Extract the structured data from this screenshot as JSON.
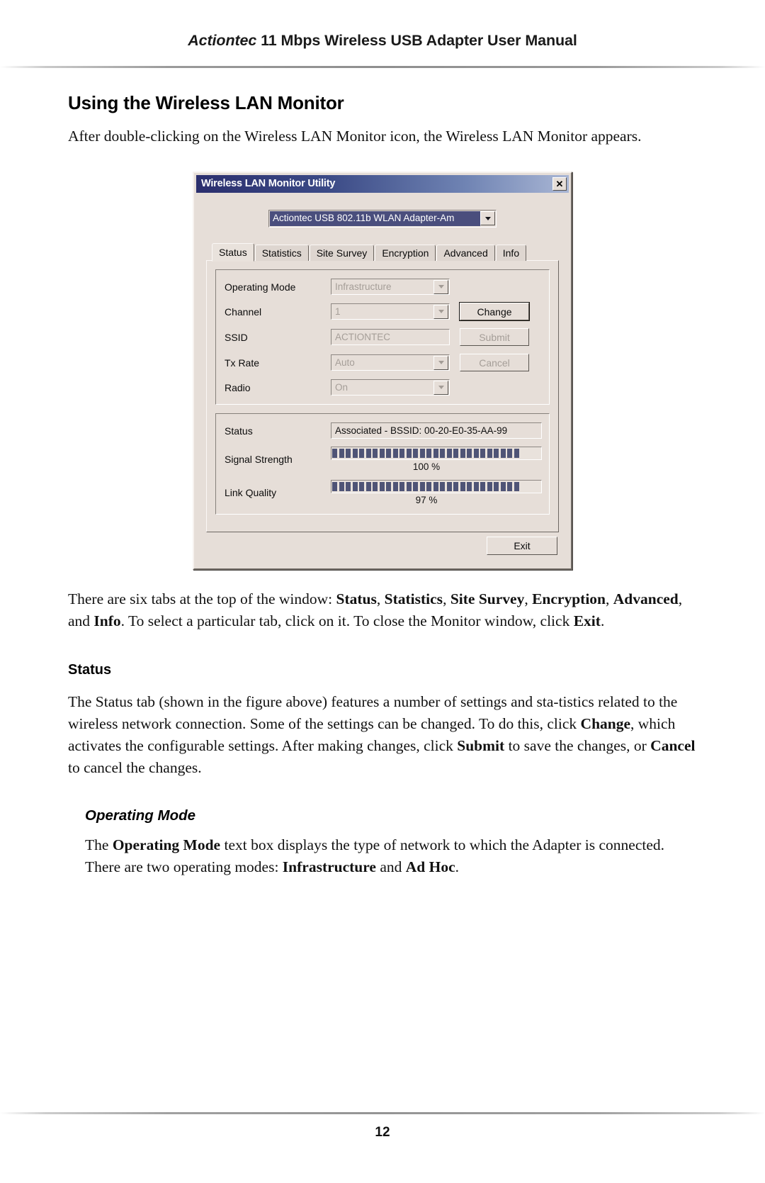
{
  "header": {
    "brand": "Actiontec",
    "title_rest": " 11 Mbps Wireless USB Adapter User Manual"
  },
  "section": {
    "title": "Using the Wireless LAN Monitor",
    "intro": "After double-clicking on the  Wireless LAN Monitor icon, the Wireless LAN Monitor appears."
  },
  "dialog": {
    "title": "Wireless LAN Monitor Utility",
    "close_label": "✕",
    "adapter": {
      "value": "Actiontec USB 802.11b WLAN Adapter-Am"
    },
    "tabs": [
      {
        "label": "Status",
        "active": true
      },
      {
        "label": "Statistics",
        "active": false
      },
      {
        "label": "Site Survey",
        "active": false
      },
      {
        "label": "Encryption",
        "active": false
      },
      {
        "label": "Advanced",
        "active": false
      },
      {
        "label": "Info",
        "active": false
      }
    ],
    "settings": [
      {
        "label": "Operating Mode",
        "value": "Infrastructure",
        "type": "combo",
        "enabled": false
      },
      {
        "label": "Channel",
        "value": "1",
        "type": "combo",
        "enabled": false
      },
      {
        "label": "SSID",
        "value": "ACTIONTEC",
        "type": "text",
        "enabled": false
      },
      {
        "label": "Tx Rate",
        "value": "Auto",
        "type": "combo",
        "enabled": false
      },
      {
        "label": "Radio",
        "value": "On",
        "type": "combo",
        "enabled": false
      }
    ],
    "buttons": {
      "change": "Change",
      "submit": "Submit",
      "cancel": "Cancel",
      "exit": "Exit"
    },
    "status": {
      "status_label": "Status",
      "status_value": "Associated - BSSID: 00-20-E0-35-AA-99",
      "signal_label": "Signal Strength",
      "signal_pct": "100 %",
      "signal_segments": 28,
      "link_label": "Link Quality",
      "link_pct": "97 %",
      "link_segments": 28
    }
  },
  "paragraphs": {
    "tabs_note_1": "There are six tabs at the top of the window: ",
    "tabs_note_b1": "Status",
    "tabs_note_2": ", ",
    "tabs_note_b2": "Statistics",
    "tabs_note_3": ", ",
    "tabs_note_b3": "Site Survey",
    "tabs_note_4": ", ",
    "tabs_note_b4": "Encryption",
    "tabs_note_5": ", ",
    "tabs_note_b5": "Advanced",
    "tabs_note_6": ", and ",
    "tabs_note_b6": "Info",
    "tabs_note_7": ". To select a particular tab, click on it. To close the Monitor window, click ",
    "tabs_note_b7": "Exit",
    "tabs_note_8": "."
  },
  "status_section": {
    "heading": "Status",
    "p1_a": "The Status tab (shown in the figure above) features a number of settings and sta-tistics related to the wireless network connection. Some of the settings can be changed. To do this, click ",
    "p1_b1": "Change",
    "p1_b": ", which activates the configurable settings. After making changes, click ",
    "p1_b2": "Submit",
    "p1_c": " to save the changes, or ",
    "p1_b3": "Cancel",
    "p1_d": " to cancel the changes."
  },
  "operating_mode_section": {
    "heading": "Operating Mode",
    "p1_a": "The ",
    "p1_b1": "Operating Mode",
    "p1_b": " text box displays the type of network to which the Adapter is connected. There are two operating modes: ",
    "p1_b2": "Infrastructure",
    "p1_c": " and ",
    "p1_b3": "Ad Hoc",
    "p1_d": "."
  },
  "footer": {
    "page_number": "12"
  },
  "colors": {
    "titlebar_start": "#2b2f6e",
    "titlebar_end": "#a9b6d4",
    "dialog_face": "#e6ded8",
    "meter_segment": "#4f5476",
    "select_highlight": "#4a4e7d"
  }
}
